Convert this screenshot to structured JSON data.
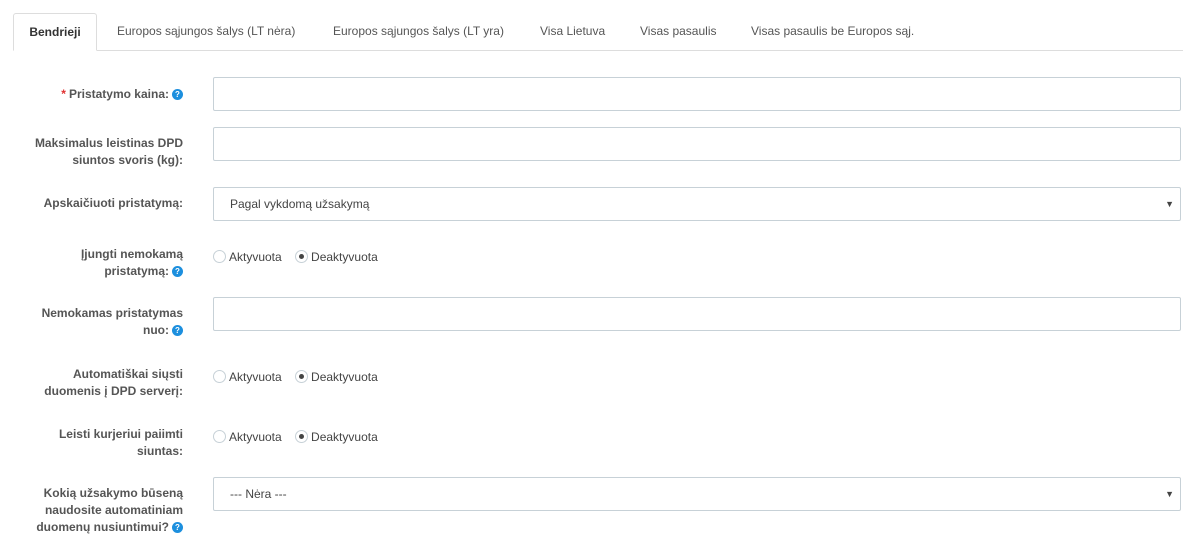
{
  "tabs": [
    {
      "label": "Bendrieji",
      "active": true
    },
    {
      "label": "Europos sąjungos šalys (LT nėra)",
      "active": false
    },
    {
      "label": "Europos sąjungos šalys (LT yra)",
      "active": false
    },
    {
      "label": "Visa Lietuva",
      "active": false
    },
    {
      "label": "Visas pasaulis",
      "active": false
    },
    {
      "label": "Visas pasaulis be Europos sąj.",
      "active": false
    }
  ],
  "form": {
    "delivery_price": {
      "required_mark": "*",
      "label": "Pristatymo kaina:",
      "value": ""
    },
    "max_weight": {
      "label_line1": "Maksimalus leistinas DPD",
      "label_line2": "siuntos svoris (kg):",
      "value": ""
    },
    "calculate": {
      "label": "Apskaičiuoti pristatymą:",
      "selected": "Pagal vykdomą užsakymą"
    },
    "free_delivery": {
      "label_line1": "Įjungti nemokamą",
      "label_line2": "pristatymą:",
      "option_on": "Aktyvuota",
      "option_off": "Deaktyvuota",
      "selected": "Deaktyvuota"
    },
    "free_from": {
      "label_line1": "Nemokamas pristatymas",
      "label_line2": "nuo:",
      "value": ""
    },
    "auto_send": {
      "label_line1": "Automatiškai siųsti",
      "label_line2": "duomenis į DPD serverį:",
      "option_on": "Aktyvuota",
      "option_off": "Deaktyvuota",
      "selected": "Deaktyvuota"
    },
    "courier_pickup": {
      "label_line1": "Leisti kurjeriui paiimti",
      "label_line2": "siuntas:",
      "option_on": "Aktyvuota",
      "option_off": "Deaktyvuota",
      "selected": "Deaktyvuota"
    },
    "order_status": {
      "label_line1": "Kokią užsakymo būseną",
      "label_line2": "naudosite automatiniam",
      "label_line3": "duomenų nusiuntimui?",
      "selected": "--- Nėra ---"
    }
  },
  "icons": {
    "help": "help-circle-icon",
    "dropdown": "caret-down-icon"
  },
  "colors": {
    "help_icon": "#1c8fde",
    "required": "#e03131"
  }
}
